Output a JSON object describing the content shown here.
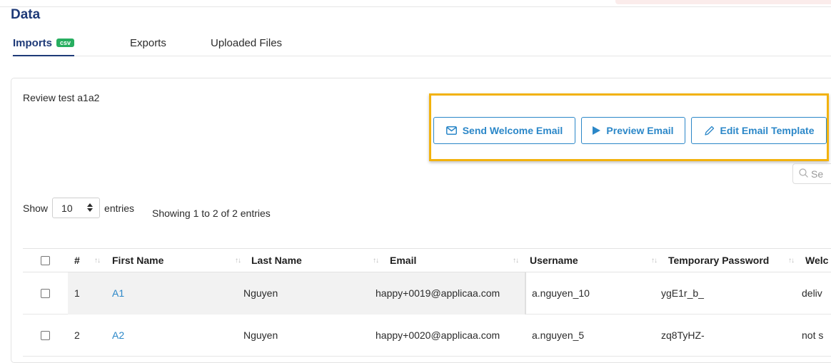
{
  "page": {
    "title": "Data"
  },
  "tabs": [
    {
      "label": "Imports",
      "badge": "csv",
      "active": true
    },
    {
      "label": "Exports",
      "active": false
    },
    {
      "label": "Uploaded Files",
      "active": false
    }
  ],
  "review": {
    "title": "Review test a1a2"
  },
  "actions": {
    "send_welcome": "Send Welcome Email",
    "preview": "Preview Email",
    "edit_template": "Edit Email Template"
  },
  "search": {
    "placeholder": "Se"
  },
  "length": {
    "prefix": "Show",
    "value": "10",
    "suffix": "entries"
  },
  "info": "Showing 1 to 2 of 2 entries",
  "table": {
    "columns": [
      "#",
      "First Name",
      "Last Name",
      "Email",
      "Username",
      "Temporary Password",
      "Welc"
    ],
    "rows": [
      {
        "num": "1",
        "first": "A1",
        "last": "Nguyen",
        "email": "happy+0019@applicaa.com",
        "username": "a.nguyen_10",
        "password": "ygE1r_b_",
        "welcome": "deliv"
      },
      {
        "num": "2",
        "first": "A2",
        "last": "Nguyen",
        "email": "happy+0020@applicaa.com",
        "username": "a.nguyen_5",
        "password": "zq8TyHZ-",
        "welcome": "not s"
      }
    ]
  },
  "colors": {
    "brand": "#1e3a78",
    "accent": "#2b87c8",
    "highlight": "#f2b20d",
    "badge": "#27ae60"
  }
}
